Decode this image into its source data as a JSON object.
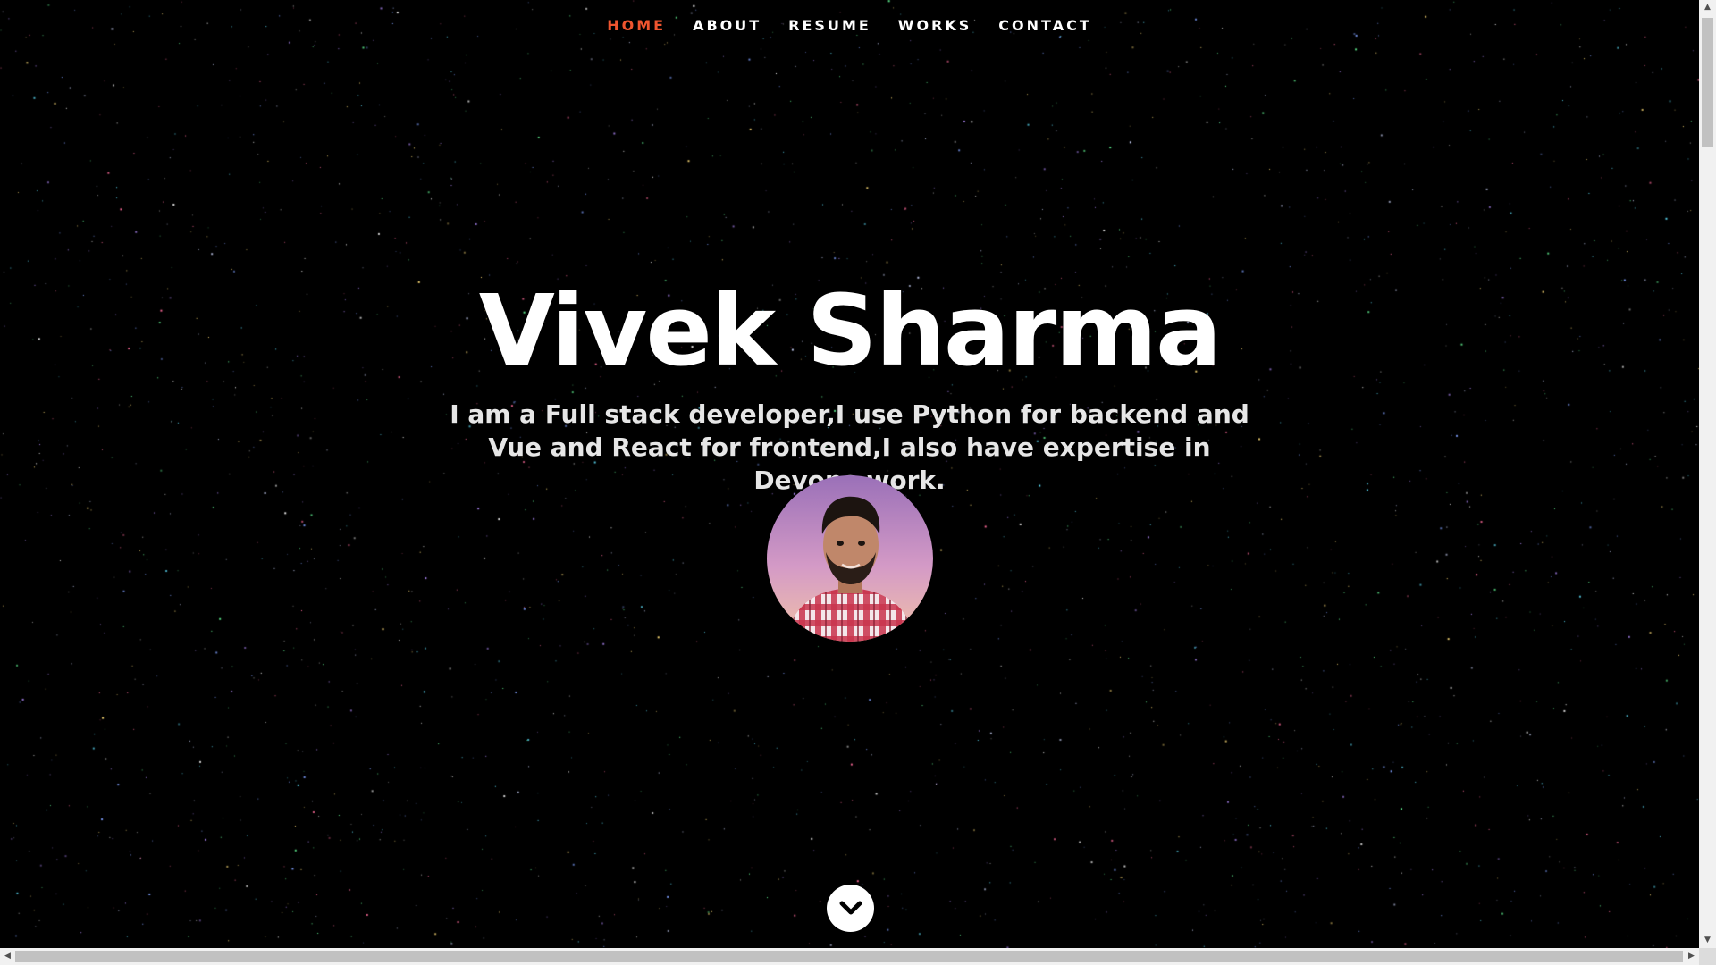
{
  "nav": {
    "items": [
      {
        "label": "HOME",
        "active": true
      },
      {
        "label": "ABOUT",
        "active": false
      },
      {
        "label": "RESUME",
        "active": false
      },
      {
        "label": "WORKS",
        "active": false
      },
      {
        "label": "CONTACT",
        "active": false
      }
    ],
    "active_color": "#f0552f"
  },
  "hero": {
    "name": "Vivek Sharma",
    "tagline": "I am a Full stack developer,I use Python for backend and Vue and React for frontend,I also have expertise in Devops work."
  },
  "icons": {
    "scroll_down": "chevron-down-icon",
    "avatar": "profile-photo"
  },
  "scrollbars": {
    "up": "▲",
    "down": "▼",
    "left": "◀",
    "right": "▶"
  }
}
